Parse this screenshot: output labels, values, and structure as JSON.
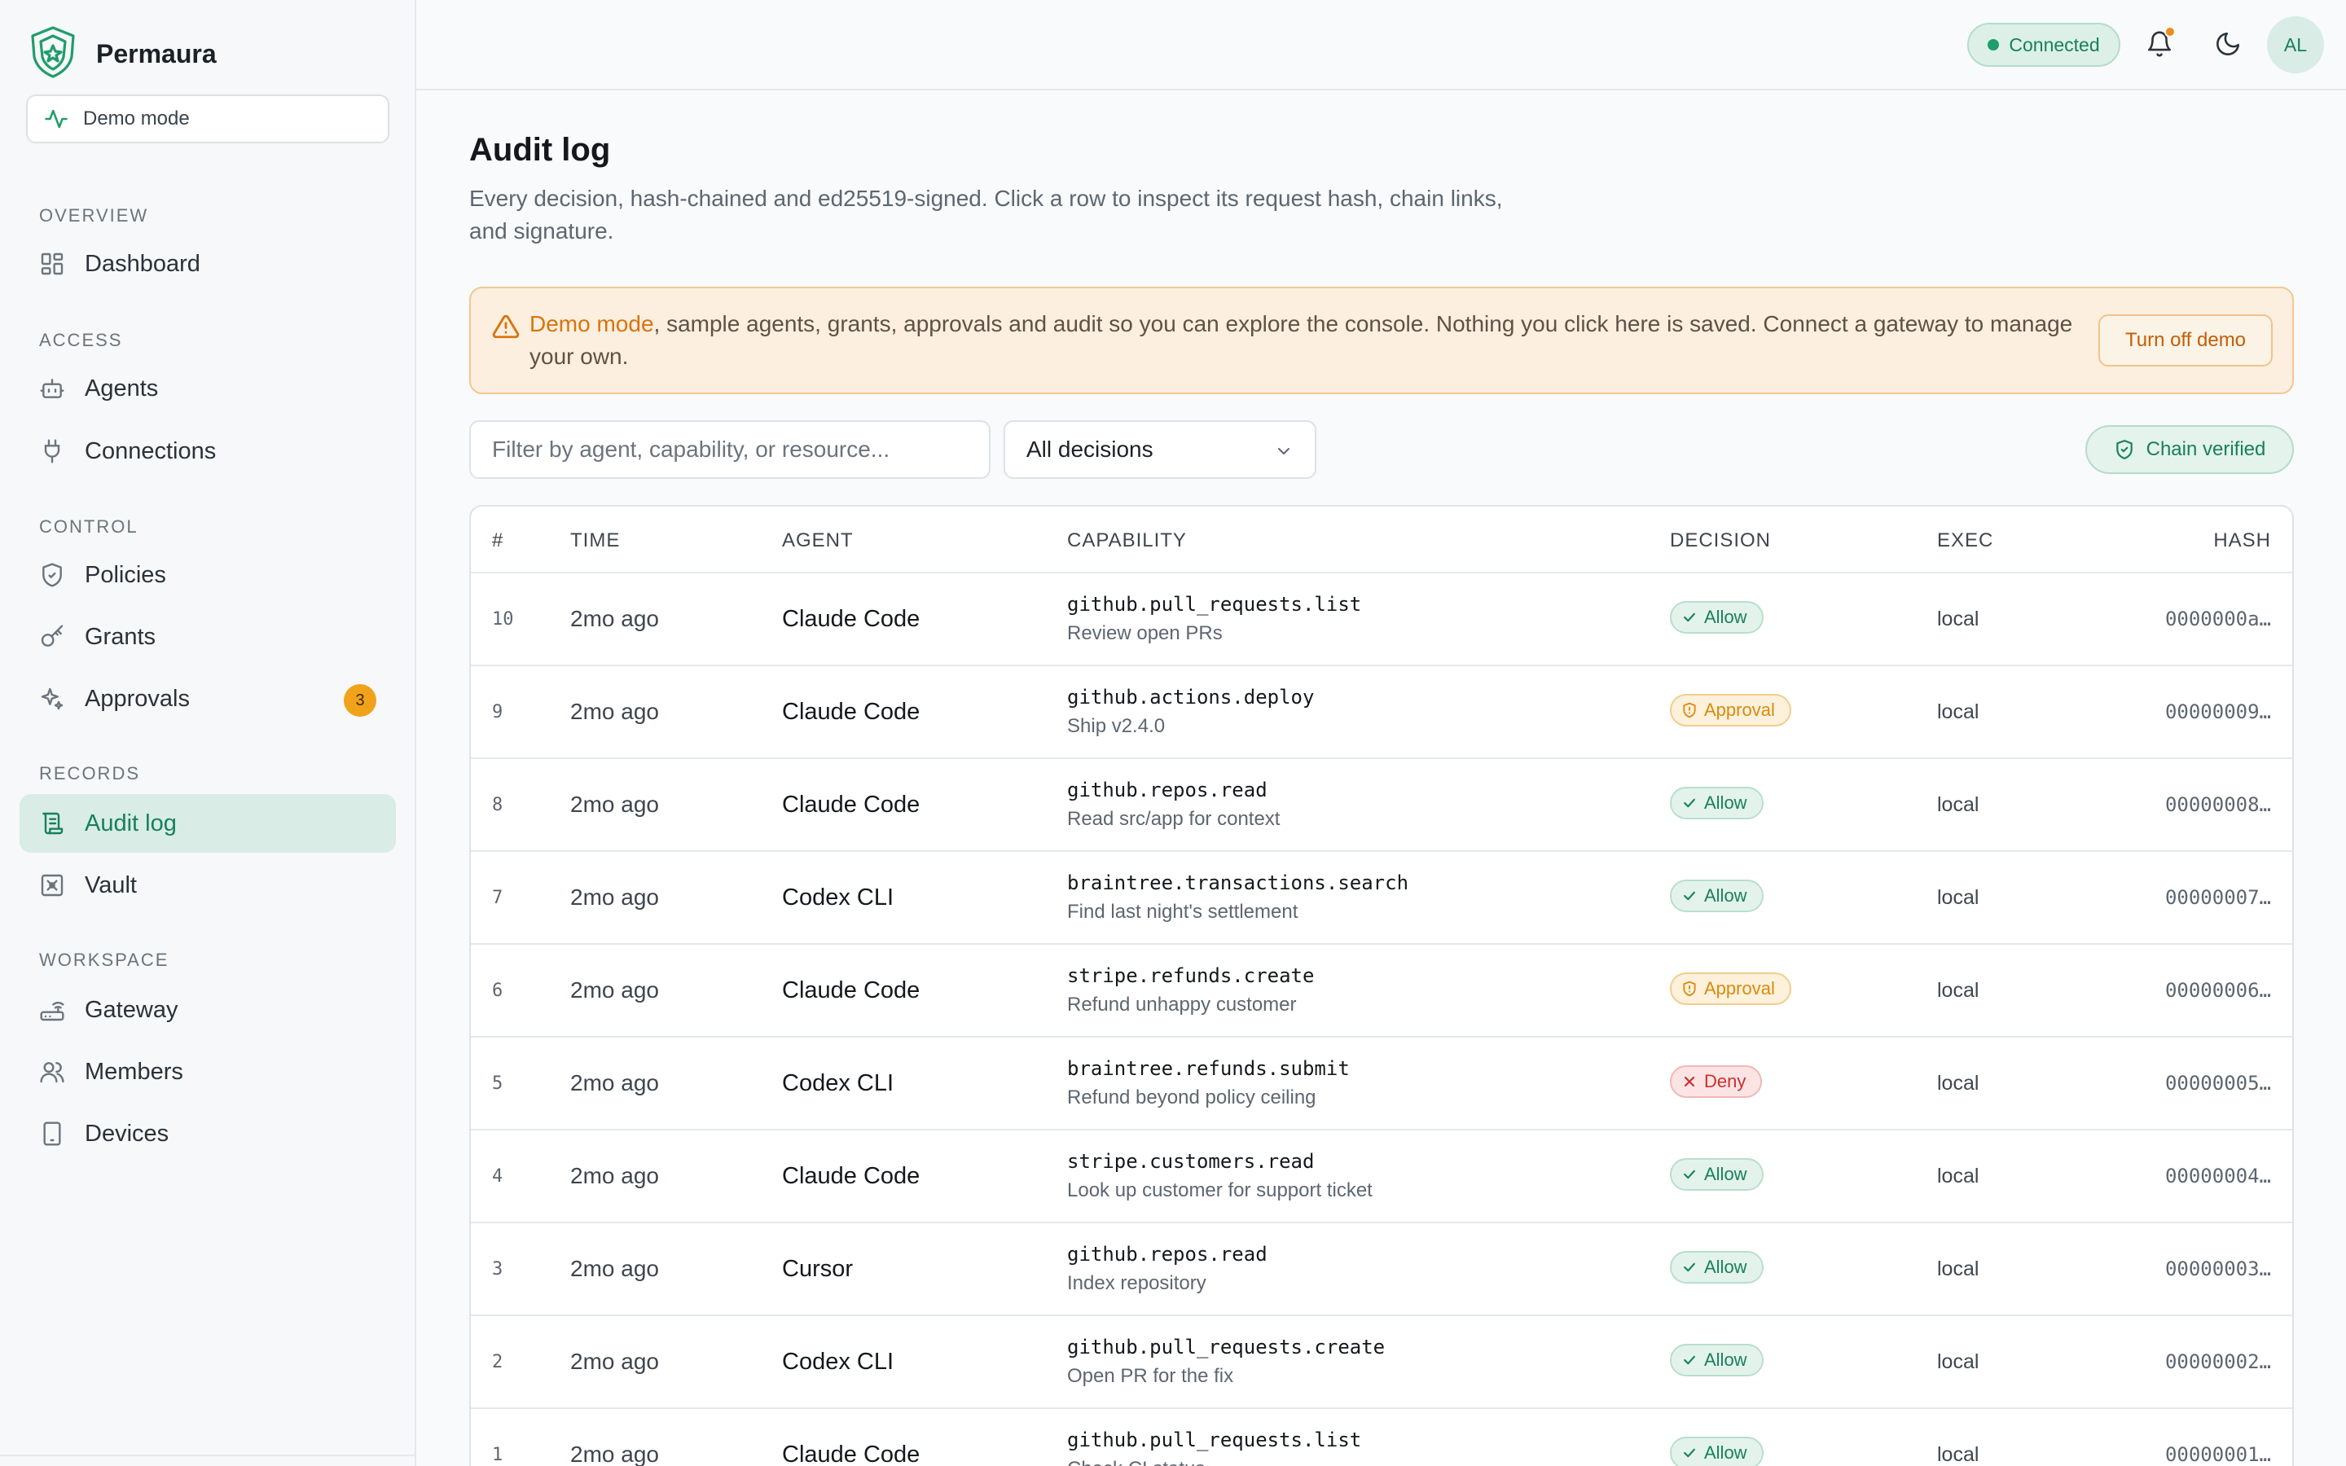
{
  "app": {
    "name": "Permaura",
    "demo_label": "Demo mode"
  },
  "nav": {
    "sections": [
      {
        "label": "OVERVIEW"
      },
      {
        "label": "ACCESS"
      },
      {
        "label": "CONTROL"
      },
      {
        "label": "RECORDS"
      },
      {
        "label": "WORKSPACE"
      }
    ],
    "items": [
      {
        "label": "Dashboard",
        "icon": "grid-icon"
      },
      {
        "label": "Agents",
        "icon": "bot-icon"
      },
      {
        "label": "Connections",
        "icon": "plug-icon"
      },
      {
        "label": "Policies",
        "icon": "shield-icon"
      },
      {
        "label": "Grants",
        "icon": "key-icon"
      },
      {
        "label": "Approvals",
        "icon": "sparkle-icon",
        "badge": "3"
      },
      {
        "label": "Audit log",
        "icon": "scroll-icon",
        "active": true
      },
      {
        "label": "Vault",
        "icon": "vault-icon"
      },
      {
        "label": "Gateway",
        "icon": "router-icon"
      },
      {
        "label": "Members",
        "icon": "users-icon"
      },
      {
        "label": "Devices",
        "icon": "device-icon"
      }
    ]
  },
  "topbar": {
    "status": "Connected",
    "avatar_initials": "AL"
  },
  "page": {
    "title": "Audit log",
    "subtitle": "Every decision, hash-chained and ed25519-signed. Click a row to inspect its request hash, chain links, and signature."
  },
  "banner": {
    "strong": "Demo mode",
    "text": ", sample agents, grants, approvals and audit so you can explore the console. Nothing you click here is saved. Connect a gateway to manage your own.",
    "button": "Turn off demo"
  },
  "filters": {
    "search_placeholder": "Filter by agent, capability, or resource...",
    "decision_select": "All decisions",
    "chain_status": "Chain verified"
  },
  "table": {
    "columns": [
      "#",
      "TIME",
      "AGENT",
      "CAPABILITY",
      "DECISION",
      "EXEC",
      "HASH"
    ],
    "rows": [
      {
        "num": "10",
        "time": "2mo ago",
        "agent": "Claude Code",
        "capability": "github.pull_requests.list",
        "desc": "Review open PRs",
        "decision": "Allow",
        "exec": "local",
        "hash": "0000000a…"
      },
      {
        "num": "9",
        "time": "2mo ago",
        "agent": "Claude Code",
        "capability": "github.actions.deploy",
        "desc": "Ship v2.4.0",
        "decision": "Approval",
        "exec": "local",
        "hash": "00000009…"
      },
      {
        "num": "8",
        "time": "2mo ago",
        "agent": "Claude Code",
        "capability": "github.repos.read",
        "desc": "Read src/app for context",
        "decision": "Allow",
        "exec": "local",
        "hash": "00000008…"
      },
      {
        "num": "7",
        "time": "2mo ago",
        "agent": "Codex CLI",
        "capability": "braintree.transactions.search",
        "desc": "Find last night's settlement",
        "decision": "Allow",
        "exec": "local",
        "hash": "00000007…"
      },
      {
        "num": "6",
        "time": "2mo ago",
        "agent": "Claude Code",
        "capability": "stripe.refunds.create",
        "desc": "Refund unhappy customer",
        "decision": "Approval",
        "exec": "local",
        "hash": "00000006…"
      },
      {
        "num": "5",
        "time": "2mo ago",
        "agent": "Codex CLI",
        "capability": "braintree.refunds.submit",
        "desc": "Refund beyond policy ceiling",
        "decision": "Deny",
        "exec": "local",
        "hash": "00000005…"
      },
      {
        "num": "4",
        "time": "2mo ago",
        "agent": "Claude Code",
        "capability": "stripe.customers.read",
        "desc": "Look up customer for support ticket",
        "decision": "Allow",
        "exec": "local",
        "hash": "00000004…"
      },
      {
        "num": "3",
        "time": "2mo ago",
        "agent": "Cursor",
        "capability": "github.repos.read",
        "desc": "Index repository",
        "decision": "Allow",
        "exec": "local",
        "hash": "00000003…"
      },
      {
        "num": "2",
        "time": "2mo ago",
        "agent": "Codex CLI",
        "capability": "github.pull_requests.create",
        "desc": "Open PR for the fix",
        "decision": "Allow",
        "exec": "local",
        "hash": "00000002…"
      },
      {
        "num": "1",
        "time": "2mo ago",
        "agent": "Claude Code",
        "capability": "github.pull_requests.list",
        "desc": "Check CI status",
        "decision": "Allow",
        "exec": "local",
        "hash": "00000001…"
      }
    ]
  },
  "colors": {
    "accent": "#17805c",
    "warning": "#d9730d",
    "deny": "#c9302c"
  }
}
